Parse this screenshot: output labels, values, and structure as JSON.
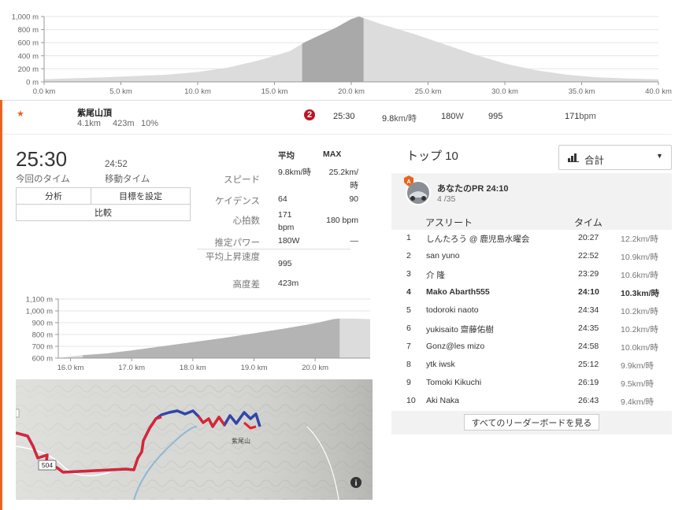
{
  "elevation_top": {
    "y_ticks": [
      "1,000 m",
      "800 m",
      "600 m",
      "400 m",
      "200 m",
      "0 m"
    ],
    "x_ticks": [
      "0.0 km",
      "5.0 km",
      "10.0 km",
      "15.0 km",
      "20.0 km",
      "25.0 km",
      "30.0 km",
      "35.0 km",
      "40.0 km"
    ],
    "ylim": [
      0,
      1000
    ],
    "xlim": [
      0,
      40
    ],
    "highlight_km": [
      16.8,
      20.8
    ],
    "profile": [
      [
        0,
        40
      ],
      [
        2,
        55
      ],
      [
        4,
        70
      ],
      [
        6,
        90
      ],
      [
        8,
        110
      ],
      [
        10,
        150
      ],
      [
        12,
        220
      ],
      [
        14,
        330
      ],
      [
        16,
        470
      ],
      [
        17,
        610
      ],
      [
        18,
        720
      ],
      [
        19,
        830
      ],
      [
        20,
        960
      ],
      [
        20.5,
        1000
      ],
      [
        21,
        960
      ],
      [
        22,
        880
      ],
      [
        24,
        740
      ],
      [
        26,
        580
      ],
      [
        28,
        420
      ],
      [
        30,
        280
      ],
      [
        32,
        180
      ],
      [
        34,
        110
      ],
      [
        36,
        70
      ],
      [
        38,
        50
      ],
      [
        40,
        40
      ]
    ]
  },
  "segment": {
    "name": "紫尾山頂",
    "distance": "4.1km",
    "elevation": "423m",
    "grade": "10%",
    "rank_badge": "2",
    "time": "25:30",
    "speed_value": "9.8",
    "speed_unit": "km/時",
    "power_value": "180",
    "power_unit": "W",
    "vam": "995",
    "hr_value": "171",
    "hr_unit": "bpm"
  },
  "summary": {
    "elapsed_time": "25:30",
    "elapsed_label": "今回のタイム",
    "moving_time": "24:52",
    "moving_label": "移動タイム"
  },
  "buttons": {
    "analyze": "分析",
    "set_goal": "目標を設定",
    "compare": "比較"
  },
  "stats": {
    "col_avg": "平均",
    "col_max": "MAX",
    "rows": [
      {
        "label": "スピード",
        "avg": "9.8km/時",
        "max": "25.2km/時"
      },
      {
        "label": "ケイデンス",
        "avg": "64",
        "max": "90"
      },
      {
        "label": "心拍数",
        "avg": "171 bpm",
        "max": "180 bpm"
      },
      {
        "label": "推定パワー",
        "avg": "180W",
        "max": "—"
      },
      {
        "label": "平均上昇速度",
        "avg": "995",
        "max": ""
      },
      {
        "label": "高度差",
        "avg": "423m",
        "max": ""
      }
    ]
  },
  "elevation_segment": {
    "y_ticks": [
      "1,100 m",
      "1,000 m",
      "900 m",
      "800 m",
      "700 m",
      "600 m"
    ],
    "x_ticks": [
      "16.0 km",
      "17.0 km",
      "18.0 km",
      "19.0 km",
      "20.0 km"
    ],
    "ylim": [
      600,
      1100
    ],
    "xlim": [
      15.8,
      20.9
    ],
    "highlight_km": [
      16.2,
      20.4
    ],
    "profile": [
      [
        15.8,
        600
      ],
      [
        16.0,
        615
      ],
      [
        16.2,
        625
      ],
      [
        16.6,
        640
      ],
      [
        17.0,
        665
      ],
      [
        17.5,
        700
      ],
      [
        18.0,
        735
      ],
      [
        18.5,
        770
      ],
      [
        19.0,
        810
      ],
      [
        19.5,
        850
      ],
      [
        20.0,
        895
      ],
      [
        20.3,
        930
      ],
      [
        20.4,
        935
      ],
      [
        20.6,
        935
      ],
      [
        20.9,
        930
      ]
    ]
  },
  "map": {
    "road_label": "504",
    "place_label": "紫尾山",
    "info_icon": "i"
  },
  "leaderboard": {
    "title": "トップ 10",
    "filter_label": "合計",
    "pr_label": "あなたのPR 24:10",
    "pr_rank": "4 /35",
    "col_athlete": "アスリート",
    "col_time": "タイム",
    "rows": [
      {
        "rank": "1",
        "name": "しんたろう @ 鹿児島水曜会",
        "time": "20:27",
        "pace": "12.2km/時"
      },
      {
        "rank": "2",
        "name": "san yuno",
        "time": "22:52",
        "pace": "10.9km/時"
      },
      {
        "rank": "3",
        "name": "介 隆",
        "time": "23:29",
        "pace": "10.6km/時"
      },
      {
        "rank": "4",
        "name": "Mako Abarth555",
        "time": "24:10",
        "pace": "10.3km/時"
      },
      {
        "rank": "5",
        "name": "todoroki naoto",
        "time": "24:34",
        "pace": "10.2km/時"
      },
      {
        "rank": "6",
        "name": "yukisaito 齋藤佑樹",
        "time": "24:35",
        "pace": "10.2km/時"
      },
      {
        "rank": "7",
        "name": "Gonz@les mizo",
        "time": "24:58",
        "pace": "10.0km/時"
      },
      {
        "rank": "8",
        "name": "ytk iwsk",
        "time": "25:12",
        "pace": "9.9km/時"
      },
      {
        "rank": "9",
        "name": "Tomoki Kikuchi",
        "time": "26:19",
        "pace": "9.5km/時"
      },
      {
        "rank": "10",
        "name": "Aki Naka",
        "time": "26:43",
        "pace": "9.4km/時"
      }
    ],
    "highlight_row": 3,
    "view_all": "すべてのリーダーボードを見る"
  },
  "colors": {
    "accent": "#e9651f",
    "badge": "#c1121f",
    "route_red": "#e8202a",
    "route_blue": "#3246a8"
  }
}
